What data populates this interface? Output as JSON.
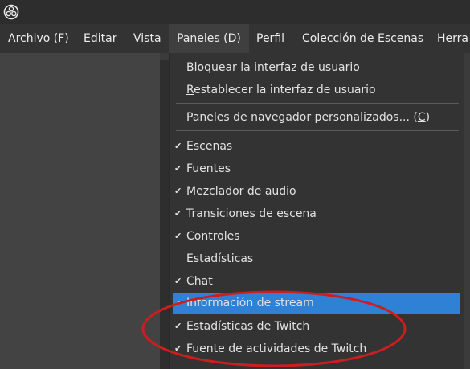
{
  "menubar": {
    "items": [
      {
        "label": "Archivo (F)"
      },
      {
        "label": "Editar"
      },
      {
        "label": "Vista"
      },
      {
        "label": "Paneles (D)"
      },
      {
        "label": "Perfil"
      },
      {
        "label": "Colección de Escenas"
      },
      {
        "label": "Herra"
      }
    ]
  },
  "dropdown": {
    "lock_prefix": "B",
    "lock_mnemonic": "l",
    "lock_suffix": "oquear la interfaz de usuario",
    "reset_mnemonic": "R",
    "reset_suffix": "establecer la interfaz de usuario",
    "browser_prefix": "Paneles de navegador personalizados... (",
    "browser_mnemonic": "C",
    "browser_suffix": ")",
    "items": [
      {
        "label": "Escenas",
        "checked": true
      },
      {
        "label": "Fuentes",
        "checked": true
      },
      {
        "label": "Mezclador de audio",
        "checked": true
      },
      {
        "label": "Transiciones de escena",
        "checked": true
      },
      {
        "label": "Controles",
        "checked": true
      },
      {
        "label": "Estadísticas",
        "checked": false
      },
      {
        "label": "Chat",
        "checked": true
      },
      {
        "label": "Información de stream",
        "checked": true
      },
      {
        "label": "Estadísticas de Twitch",
        "checked": true
      },
      {
        "label": "Fuente de actividades de Twitch",
        "checked": true
      }
    ],
    "check_glyph": "✔"
  },
  "colors": {
    "highlight": "#2e81d4",
    "annotation": "#cc1e1e"
  }
}
